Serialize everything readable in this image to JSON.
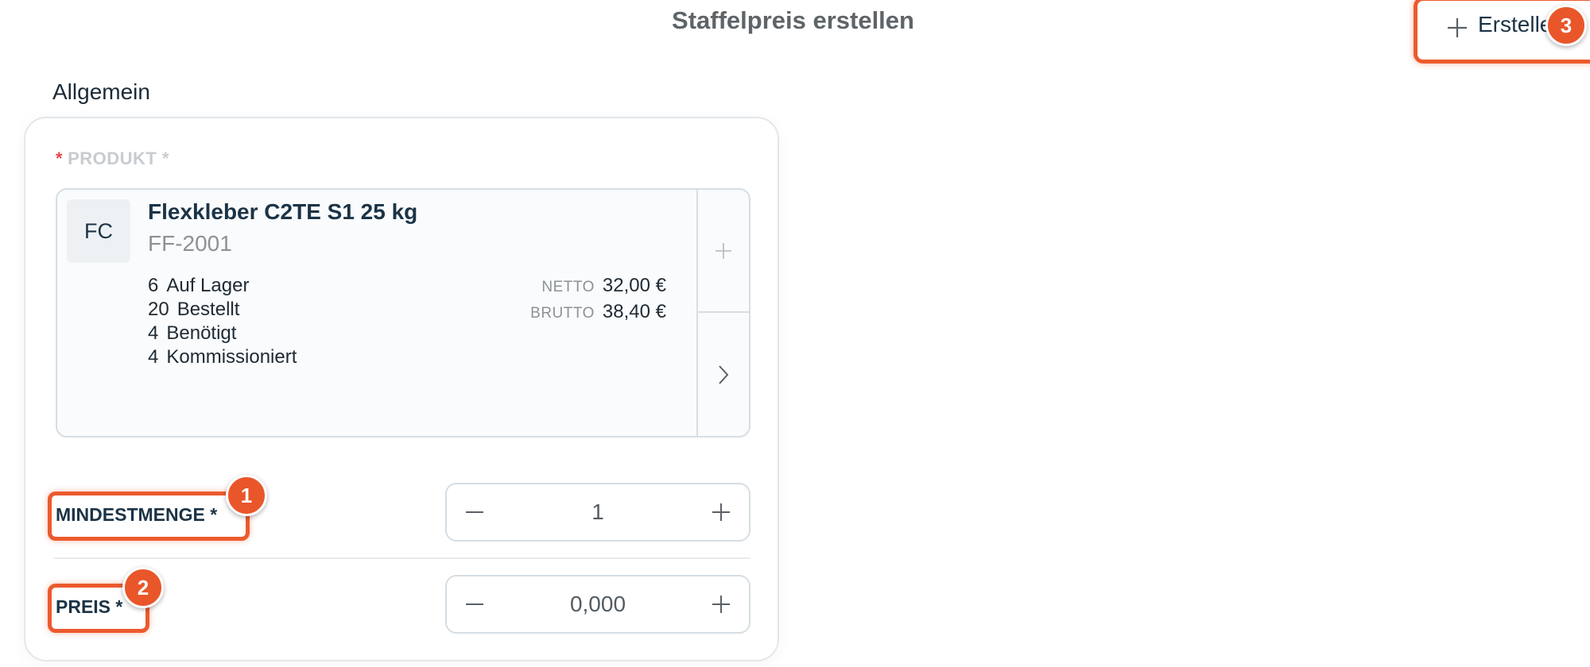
{
  "header": {
    "title": "Staffelpreis erstellen",
    "create_button_label": "Erstellen",
    "create_badge": "3"
  },
  "section": {
    "title": "Allgemein"
  },
  "product_field": {
    "required_mark": "*",
    "label": "PRODUKT *",
    "thumbnail_initials": "FC",
    "name": "Flexkleber C2TE S1 25 kg",
    "sku": "FF-2001",
    "stock": [
      {
        "qty": "6",
        "label": "Auf Lager"
      },
      {
        "qty": "20",
        "label": "Bestellt"
      },
      {
        "qty": "4",
        "label": "Benötigt"
      },
      {
        "qty": "4",
        "label": "Kommissioniert"
      }
    ],
    "prices": [
      {
        "label": "NETTO",
        "value": "32,00 €"
      },
      {
        "label": "BRUTTO",
        "value": "38,40 €"
      }
    ],
    "icons": {
      "add": "plus-icon",
      "open": "chevron-right-icon"
    }
  },
  "min_quantity": {
    "label": "MINDESTMENGE *",
    "value": "1",
    "badge": "1"
  },
  "price": {
    "label": "PREIS *",
    "value": "0,000",
    "badge": "2"
  },
  "colors": {
    "highlight": "#ec5a2e",
    "badge": "#e9562a",
    "text": "#1b3346",
    "required": "#e5484d"
  }
}
